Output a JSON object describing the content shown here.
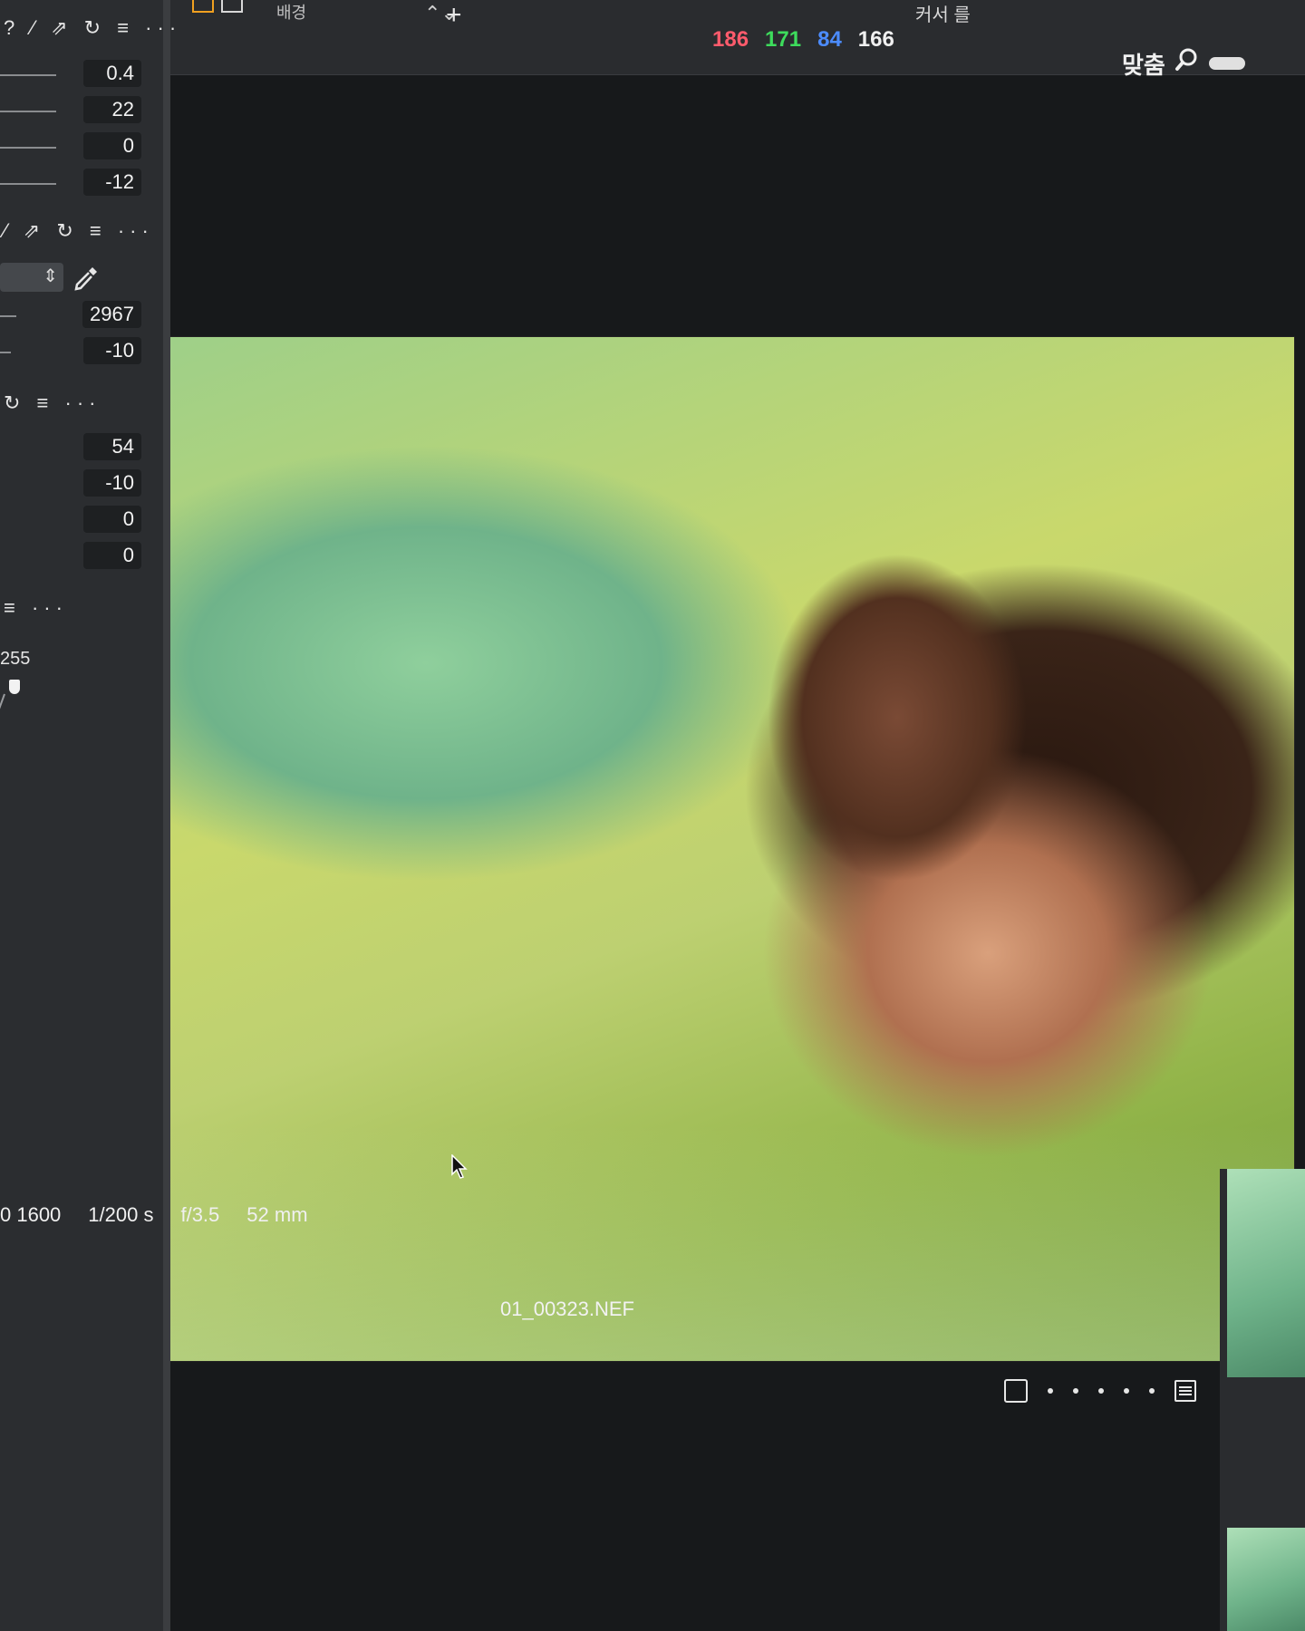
{
  "topbar": {
    "background_label": "배경",
    "cursor_label": "커서 를",
    "rgb": {
      "r": "186",
      "g": "171",
      "b": "84",
      "l": "166"
    },
    "fit_label": "맞춤",
    "updown_icon": "updown-icon",
    "crosshair_icon": "crosshair-icon",
    "zoom_icon": "magnifier-icon"
  },
  "sidepanel": {
    "toolbar_1": "? ⁄ ⇗ ↻ ≡ ···",
    "toolbar_2": "⁄ ⇗ ↻ ≡ ···",
    "toolbar_3": "↻ ≡ ···",
    "toolbar_4": "≡ ···",
    "params_a": [
      "0.4",
      "22",
      "0",
      "-12"
    ],
    "params_b": [
      "2967",
      "-10"
    ],
    "params_c": [
      "54",
      "-10",
      "0",
      "0"
    ],
    "level_value": "255"
  },
  "photo": {
    "exif": {
      "iso": "0 1600",
      "shutter": "1/200 s",
      "aperture": "f/3.5",
      "focal": "52 mm"
    },
    "filename": "01_00323.NEF"
  },
  "colors": {
    "accent_orange": "#f0a020",
    "red_channel": "#ff5b6c",
    "green_channel": "#3ddc5c",
    "blue_channel": "#4c8cff"
  }
}
